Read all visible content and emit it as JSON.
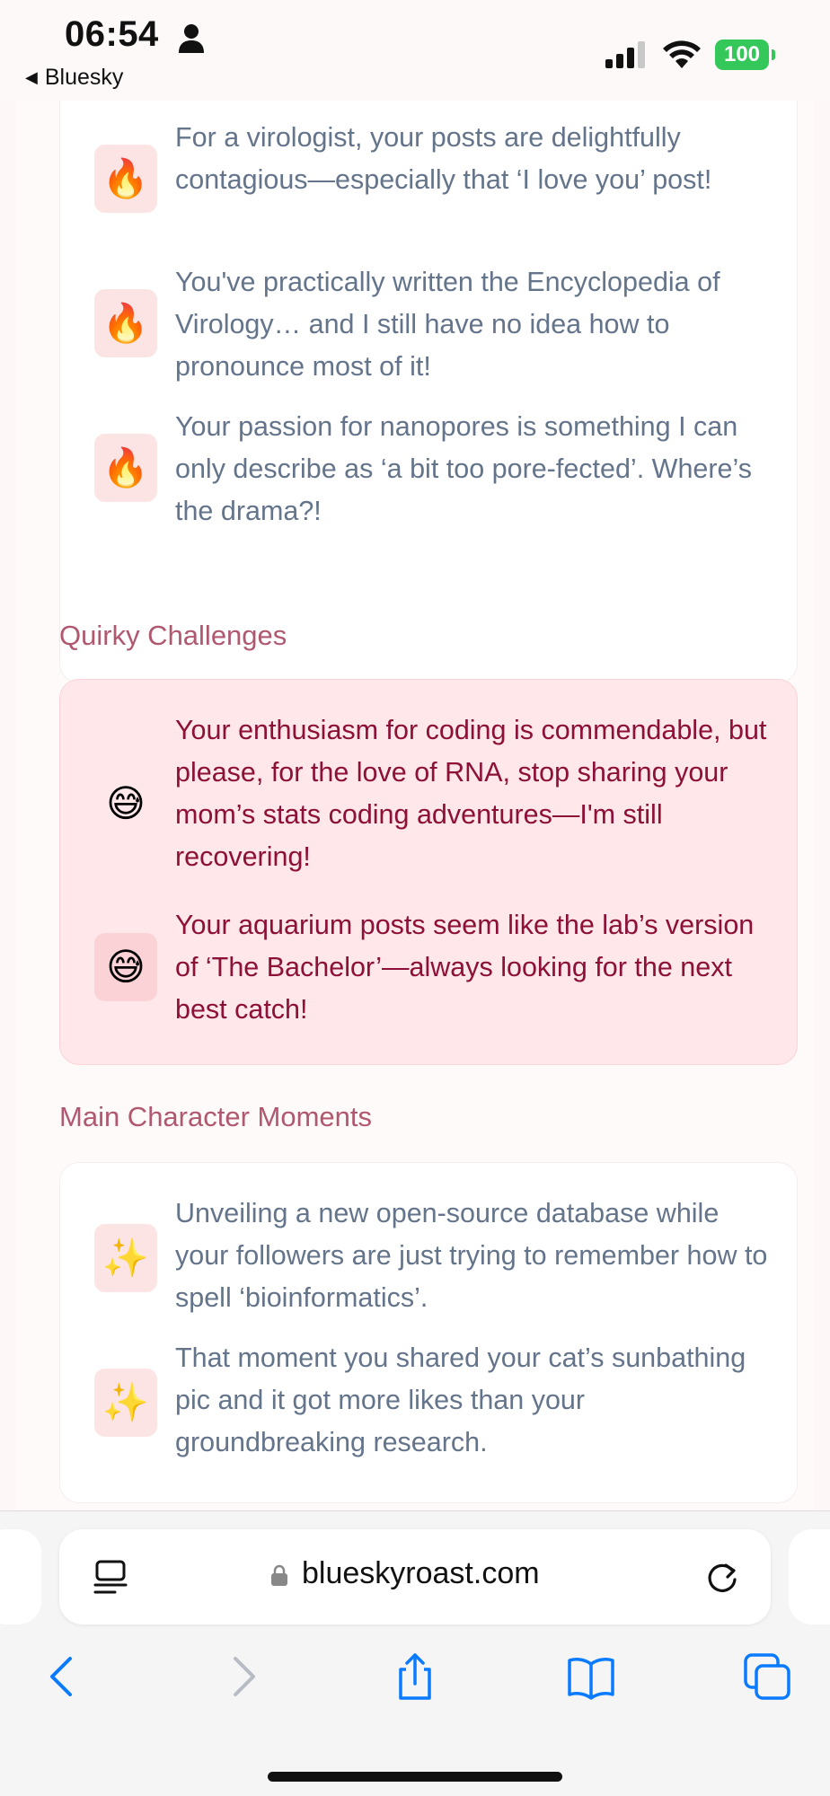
{
  "status_bar": {
    "time": "06:54",
    "back_label": "Bluesky",
    "battery": "100",
    "battery_color": "#34c759"
  },
  "roast_items": [
    {
      "emoji": "🔥",
      "text": "For a virologist, your posts are delightfully contagious—especially that ‘I love you’ post!"
    },
    {
      "emoji": "🔥",
      "text": "You've practically written the Encyclopedia of Virology… and I still have no idea how to pronounce most of it!"
    },
    {
      "emoji": "🔥",
      "text": "Your passion for nanopores is something I can only describe as ‘a bit too pore-fected’. Where’s the drama?!"
    }
  ],
  "quirky": {
    "title": "Quirky Challenges",
    "items": [
      {
        "emoji": "😅",
        "text": "Your enthusiasm for coding is commendable, but please, for the love of RNA, stop sharing your mom’s stats coding adventures—I'm still recovering!"
      },
      {
        "emoji": "😅",
        "text": "Your aquarium posts seem like the lab’s version of ‘The Bachelor’—always looking for the next best catch!"
      }
    ]
  },
  "main_character": {
    "title": "Main Character Moments",
    "items": [
      {
        "emoji": "✨",
        "text": "Unveiling a new open-source database while your followers are just trying to remember how to spell ‘bioinformatics’."
      },
      {
        "emoji": "✨",
        "text": "That moment you shared your cat’s sunbathing pic and it got more likes than your groundbreaking research."
      }
    ]
  },
  "browser": {
    "url": "blueskyroast.com",
    "accent": "#0a7aff"
  },
  "colors": {
    "section_title": "#b0586f",
    "pink_text": "#8c1037",
    "gray_text": "#64748b"
  }
}
